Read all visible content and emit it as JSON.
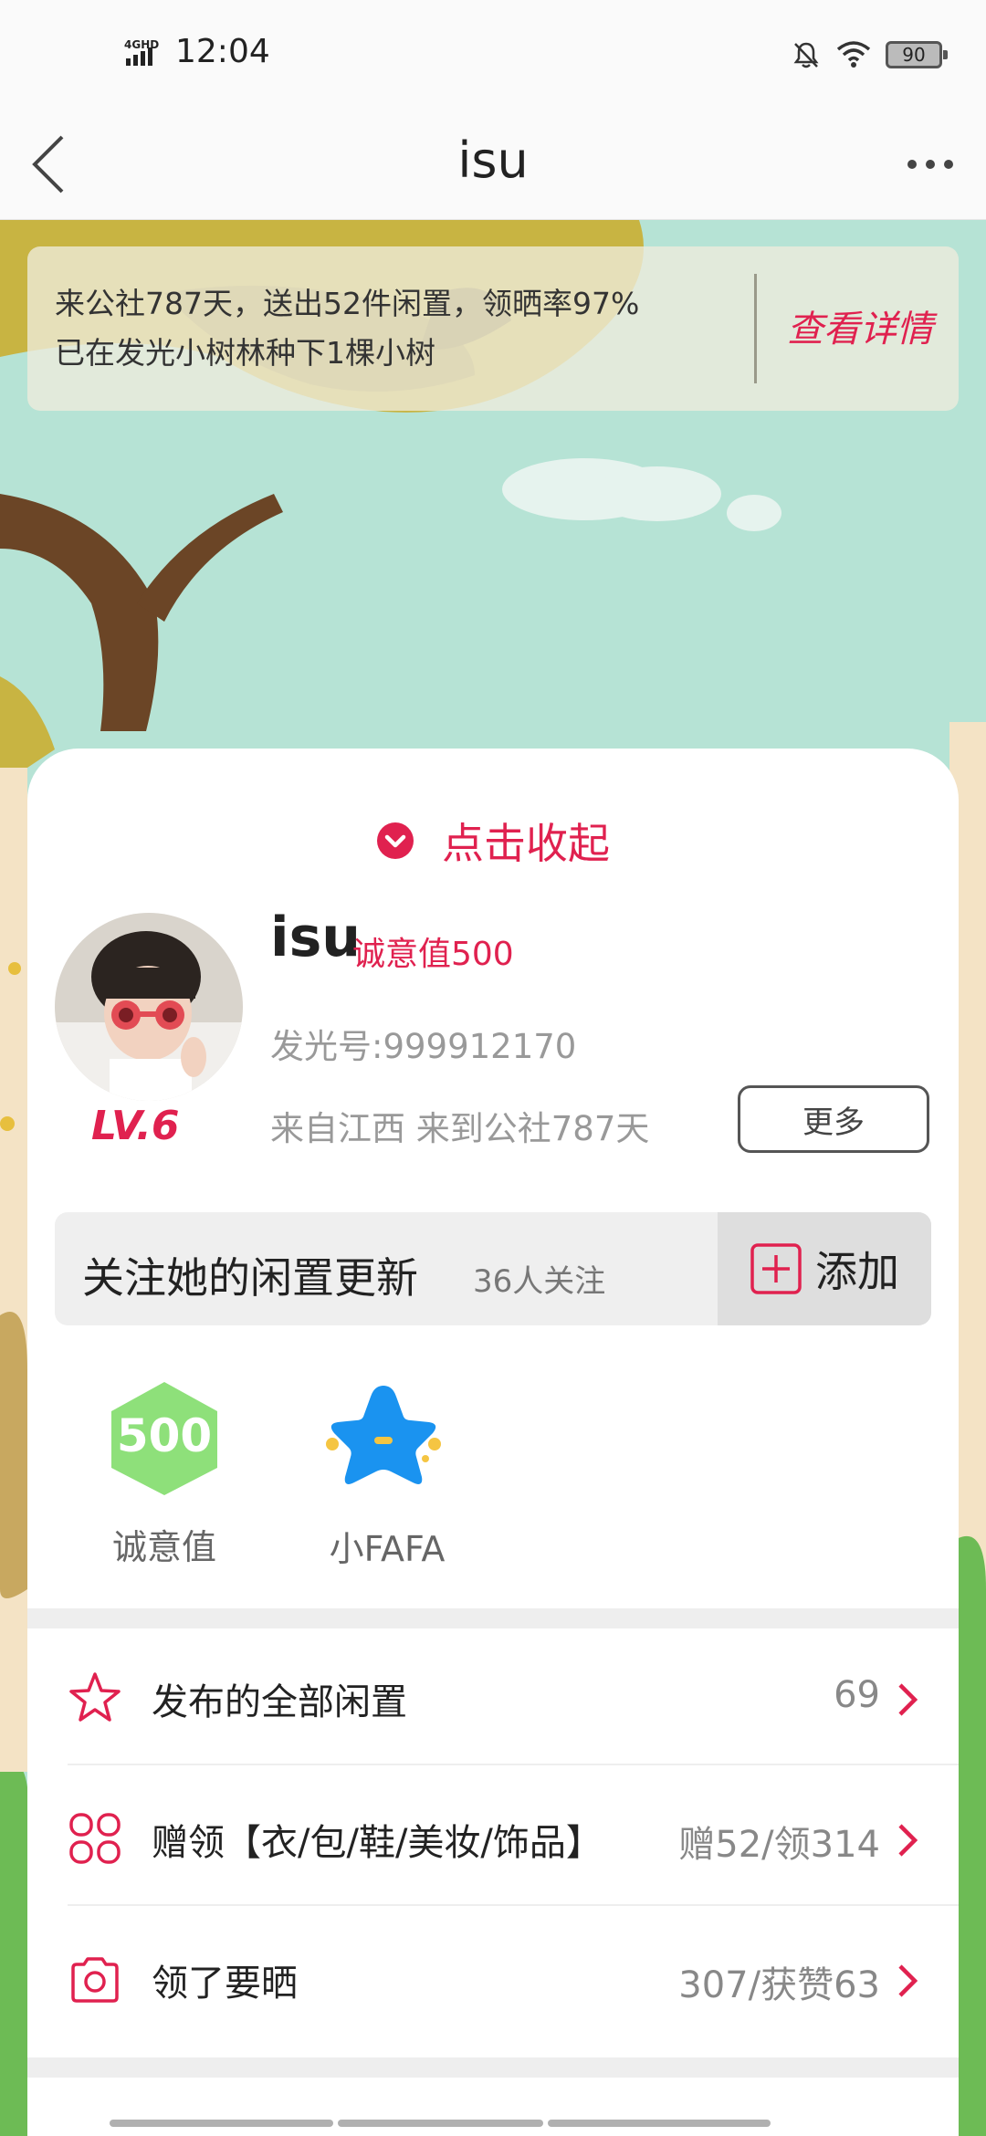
{
  "status_bar": {
    "network": "4GHD",
    "time": "12:04",
    "battery": "90",
    "icons": [
      "signal-icon",
      "mute-bell-icon",
      "wifi-icon",
      "battery-icon"
    ]
  },
  "nav": {
    "title": "isu",
    "icons": [
      "back-arrow-icon",
      "more-dots-icon"
    ]
  },
  "banner": {
    "line1": "来公社787天，送出52件闲置，领晒率97%",
    "line2": "已在发光小树林种下1棵小树",
    "link": "查看详情"
  },
  "profile": {
    "collapse_label": "点击收起",
    "name": "isu",
    "sincerity": "诚意值500",
    "level": "LV.6",
    "uid": "发光号:999912170",
    "origin": "来自江西 来到公社787天",
    "more_button": "更多"
  },
  "follow": {
    "text": "关注她的闲置更新",
    "count": "36人关注",
    "add_label": "添加"
  },
  "badges": [
    {
      "value": "500",
      "label": "诚意值",
      "color": "#8ee07a"
    },
    {
      "label": "小FAFA",
      "color": "#1a93f0"
    }
  ],
  "list": [
    {
      "icon": "star-icon",
      "label": "发布的全部闲置",
      "value": "69"
    },
    {
      "icon": "grid-icon",
      "label": "赠领【衣/包/鞋/美妆/饰品】",
      "value": "赠52/领314"
    },
    {
      "icon": "camera-icon",
      "label": "领了要晒",
      "value": "307/获赞63"
    }
  ],
  "colors": {
    "accent": "#e0214f",
    "sky": "#b6e3d5",
    "tree_canopy": "#c8b442",
    "tree_trunk": "#6b4526",
    "grass": "#6dbb55"
  }
}
